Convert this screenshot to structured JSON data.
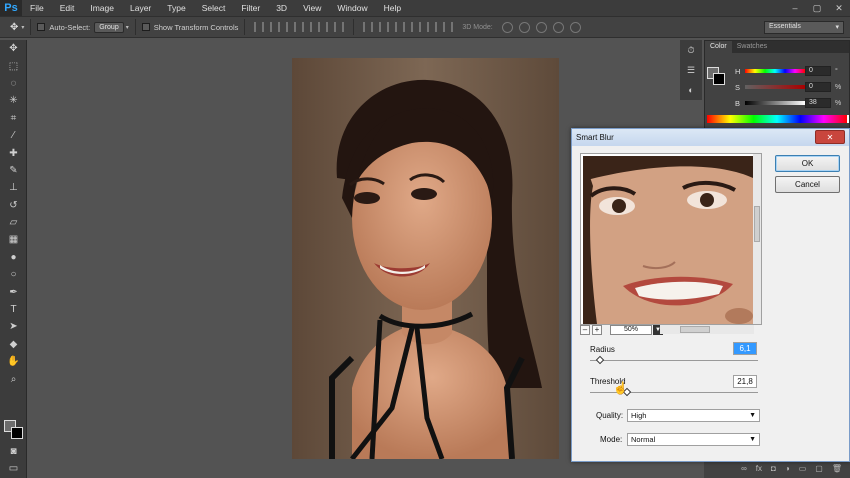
{
  "app": {
    "logo": "Ps"
  },
  "menu": [
    "File",
    "Edit",
    "Image",
    "Layer",
    "Type",
    "Select",
    "Filter",
    "3D",
    "View",
    "Window",
    "Help"
  ],
  "window_controls": [
    "–",
    "▢",
    "✕"
  ],
  "options": {
    "auto_select_label": "Auto-Select:",
    "auto_select_value": "Group",
    "transform_label": "Show Transform Controls",
    "mode_3d_label": "3D Mode:",
    "workspace": "Essentials"
  },
  "tools": [
    "move",
    "marquee",
    "lasso",
    "quick-select",
    "crop",
    "eyedropper",
    "healing",
    "brush",
    "clone-stamp",
    "history-brush",
    "eraser",
    "gradient",
    "blur",
    "dodge",
    "pen",
    "type",
    "path-select",
    "shape",
    "hand",
    "zoom",
    "extra"
  ],
  "colors": {
    "foreground": "#6d6d6d",
    "background": "#000000",
    "accent": "#31a8ff"
  },
  "color_panel": {
    "tabs": [
      "Color",
      "Swatches"
    ],
    "rows": [
      {
        "label": "H",
        "value": "0",
        "unit": "°"
      },
      {
        "label": "S",
        "value": "0",
        "unit": "%"
      },
      {
        "label": "B",
        "value": "38",
        "unit": "%"
      }
    ]
  },
  "layers_footer_icons": [
    "link",
    "fx",
    "mask",
    "adjustment",
    "group",
    "new-layer",
    "trash"
  ],
  "dialog": {
    "title": "Smart Blur",
    "close": "✕",
    "ok": "OK",
    "cancel": "Cancel",
    "zoom_out": "–",
    "zoom_in": "+",
    "zoom": "50%",
    "radius_label": "Radius",
    "radius_value": "6,1",
    "radius_level": 0.06,
    "threshold_label": "Threshold",
    "threshold_value": "21,8",
    "threshold_level": 0.22,
    "quality_label": "Quality:",
    "quality_value": "High",
    "mode_label": "Mode:",
    "mode_value": "Normal"
  }
}
